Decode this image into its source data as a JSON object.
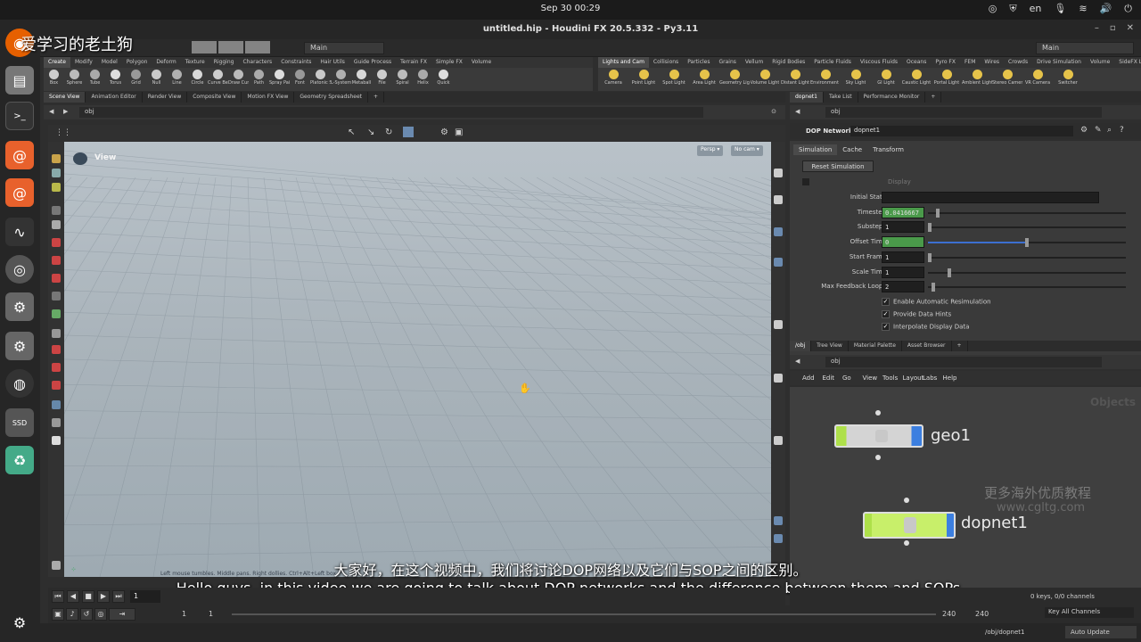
{
  "os": {
    "clock": "Sep 30  00:29",
    "lang": "en"
  },
  "window": {
    "title": "untitled.hip - Houdini FX 20.5.332 - Py3.11",
    "desktop_left": "Main",
    "desktop_right": "Main",
    "watermark": "爱学习的老土狗"
  },
  "shelf_left": {
    "tabs": [
      "Create",
      "Modify",
      "Model",
      "Polygon",
      "Deform",
      "Texture",
      "Rigging",
      "Characters",
      "Constraints",
      "Hair Utils",
      "Guide Process",
      "Terrain FX",
      "Simple FX",
      "Volume"
    ],
    "tools": [
      "Box",
      "Sphere",
      "Tube",
      "Torus",
      "Grid",
      "Null",
      "Line",
      "Circle",
      "Curve Bezier",
      "Draw Curve",
      "Path",
      "Spray Paint",
      "Font",
      "Platonic Solids",
      "L-System",
      "Metaball",
      "File",
      "Spiral",
      "Helix",
      "Quick"
    ]
  },
  "shelf_right": {
    "tabs": [
      "Lights and Cam",
      "Collisions",
      "Particles",
      "Grains",
      "Vellum",
      "Rigid Bodies",
      "Particle Fluids",
      "Viscous Fluids",
      "Oceans",
      "Pyro FX",
      "FEM",
      "Wires",
      "Crowds",
      "Drive Simulation",
      "Volume",
      "SideFX Labs"
    ],
    "tools": [
      "Camera",
      "Point Light",
      "Spot Light",
      "Area Light",
      "Geometry Light",
      "Volume Light",
      "Distant Light",
      "Environment Light",
      "Sky Light",
      "GI Light",
      "Caustic Light",
      "Portal Light",
      "Ambient Light",
      "Stereo Camera",
      "VR Camera",
      "Switcher"
    ]
  },
  "left_pane": {
    "tabs": [
      "Scene View",
      "Animation Editor",
      "Render View",
      "Composite View",
      "Motion FX View",
      "Geometry Spreadsheet"
    ],
    "path": "obj",
    "view_label": "View",
    "persp": "Persp",
    "cam": "No cam",
    "status_hint": "Left mouse tumbles. Middle pans. Right dollies. Ctrl+Alt+Left box"
  },
  "params_pane": {
    "tabs": [
      "dopnet1",
      "Take List",
      "Performance Monitor"
    ],
    "path": "obj",
    "type": "DOP Network",
    "name": "dopnet1",
    "subtabs": [
      "Simulation",
      "Cache",
      "Transform"
    ],
    "reset_button": "Reset Simulation",
    "display_label": "Display",
    "rows": [
      {
        "label": "Initial State",
        "value": "",
        "slider": 0
      },
      {
        "label": "Timestep",
        "value": "0.0416667",
        "slider": 0.04
      },
      {
        "label": "Substeps",
        "value": "1",
        "slider": 0
      },
      {
        "label": "Offset Time",
        "value": "0",
        "slider": 0.5
      },
      {
        "label": "Start Frame",
        "value": "1",
        "slider": 0
      },
      {
        "label": "Scale Time",
        "value": "1",
        "slider": 0.1
      },
      {
        "label": "Max Feedback Loops",
        "value": "2",
        "slider": 0.02
      }
    ],
    "checks": [
      "Enable Automatic Resimulation",
      "Provide Data Hints",
      "Interpolate Display Data"
    ]
  },
  "network_pane": {
    "tabs": [
      "/obj",
      "Tree View",
      "Material Palette",
      "Asset Browser"
    ],
    "path": "obj",
    "menu": [
      "Add",
      "Edit",
      "Go",
      "View",
      "Tools",
      "Layout",
      "Labs",
      "Help"
    ],
    "context_label": "Objects",
    "nodes": [
      {
        "name": "geo1"
      },
      {
        "name": "dopnet1"
      }
    ],
    "watermark_cn": "更多海外优质教程",
    "watermark_url": "www.cgltg.com"
  },
  "subtitles": {
    "chinese": "大家好，在这个视频中，我们将讨论DOP网络以及它们与SOP之间的区别。",
    "english": "Hello guys, in this video we are going to talk about DOP networks and the difference between them and SOPs."
  },
  "timeline": {
    "frame": "1",
    "start": "1",
    "start2": "1",
    "end": "240",
    "end2": "240",
    "keys_info": "0 keys, 0/0 channels",
    "key_all": "Key All Channels",
    "status_path": "/obj/dopnet1",
    "auto_update": "Auto Update"
  }
}
